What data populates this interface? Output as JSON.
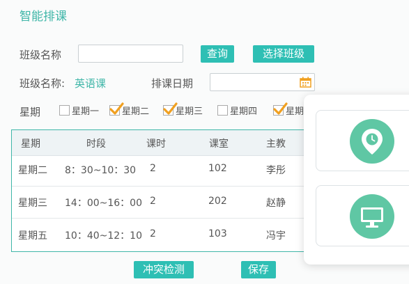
{
  "header": {
    "title": "智能排课"
  },
  "form": {
    "class_name_label": "班级名称",
    "class_name_value": "",
    "query_button": "查询",
    "select_class_button": "选择班级",
    "current_class_label": "班级名称:",
    "current_class_value": "英语课",
    "schedule_date_label": "排课日期",
    "schedule_date_value": ""
  },
  "weekdays": {
    "label": "星期",
    "items": [
      {
        "label": "星期一",
        "checked": false
      },
      {
        "label": "星期二",
        "checked": true
      },
      {
        "label": "星期三",
        "checked": true
      },
      {
        "label": "星期四",
        "checked": false
      },
      {
        "label": "星期",
        "checked": true
      }
    ]
  },
  "table": {
    "headers": [
      "星期",
      "时段",
      "课时",
      "课室",
      "主教"
    ],
    "rows": [
      [
        "星期二",
        "8：30~10：30",
        "2",
        "102",
        "李彤"
      ],
      [
        "星期三",
        "14：00~16：00",
        "2",
        "202",
        "赵静"
      ],
      [
        "星期五",
        "10：40~12：10",
        "2",
        "103",
        "冯宇"
      ]
    ]
  },
  "actions": {
    "conflict_check_button": "冲突检测",
    "save_button": "保存"
  },
  "side_panel": {
    "icons": [
      "clock-pin-icon",
      "monitor-icon"
    ]
  },
  "colors": {
    "accent": "#2ebfb4",
    "title": "#3fb6a8",
    "check": "#f0a020",
    "icon_circle": "#5fc7a4"
  }
}
